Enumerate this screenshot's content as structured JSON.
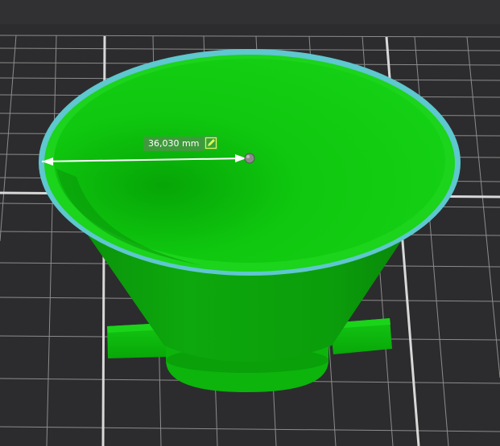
{
  "measurement": {
    "value": "36,030 mm",
    "edit_icon": "pencil-edit-icon"
  },
  "colors": {
    "background": "#2c2c2e",
    "grid": "#8c8c8c",
    "model": "#09c409",
    "rim": "#5ec7cf",
    "measure_label": "#3f9a3c"
  }
}
